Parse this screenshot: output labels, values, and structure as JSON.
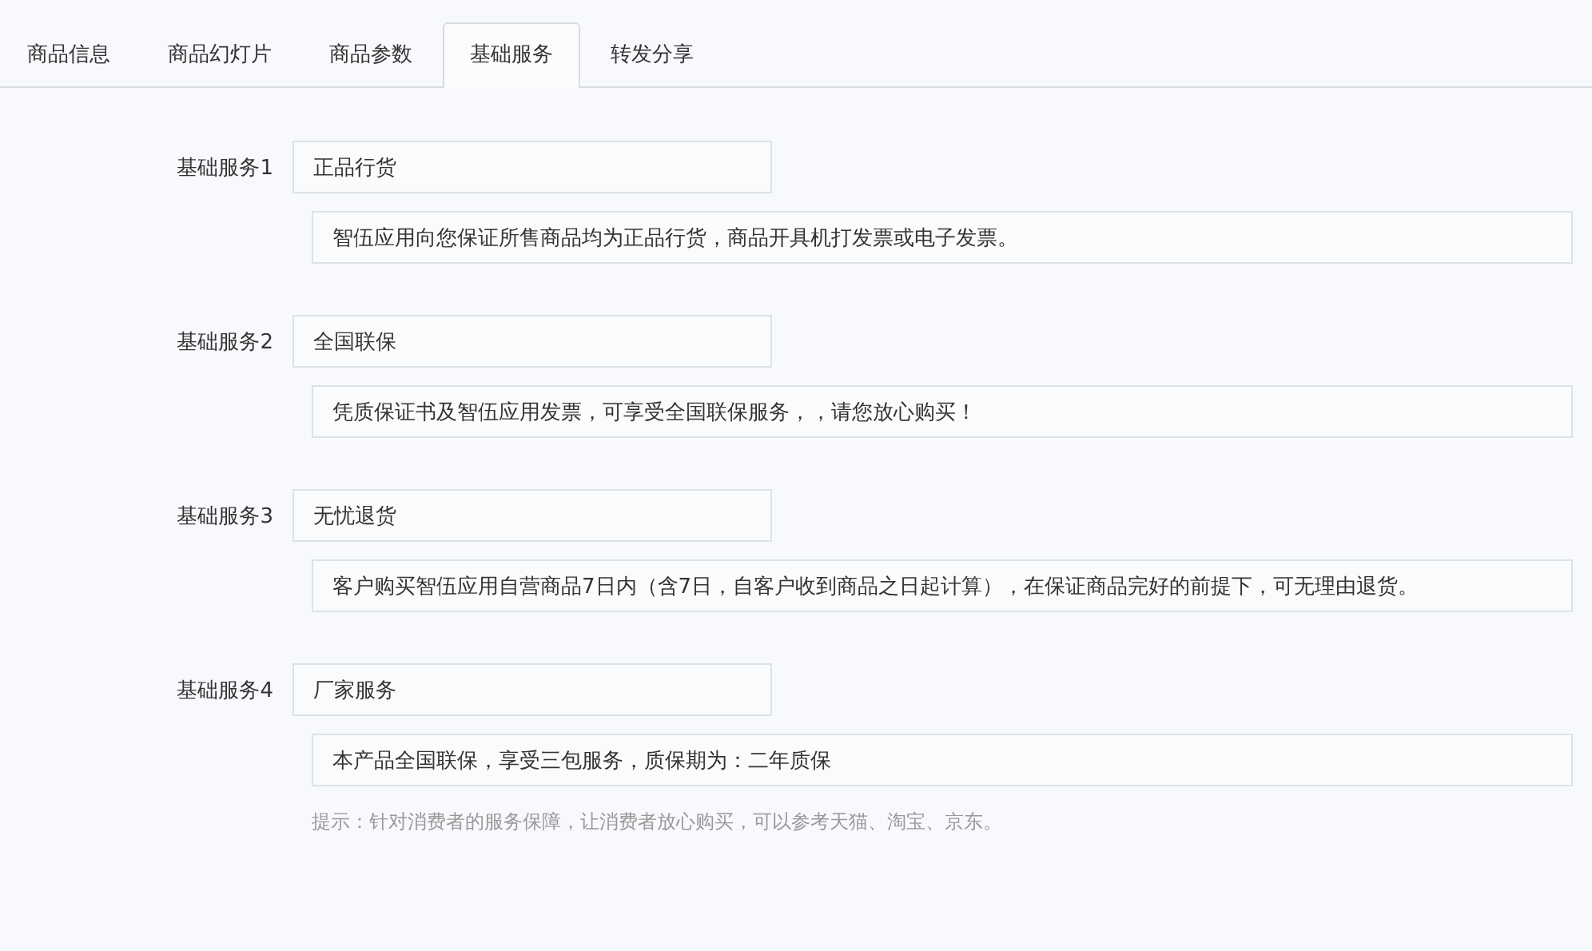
{
  "tabs": [
    {
      "label": "商品信息",
      "selected": false
    },
    {
      "label": "商品幻灯片",
      "selected": false
    },
    {
      "label": "商品参数",
      "selected": false
    },
    {
      "label": "基础服务",
      "selected": true
    },
    {
      "label": "转发分享",
      "selected": false
    }
  ],
  "services": [
    {
      "label": "基础服务1",
      "name": "正品行货",
      "description": "智伍应用向您保证所售商品均为正品行货，商品开具机打发票或电子发票。"
    },
    {
      "label": "基础服务2",
      "name": "全国联保",
      "description": "凭质保证书及智伍应用发票，可享受全国联保服务，，请您放心购买！"
    },
    {
      "label": "基础服务3",
      "name": "无忧退货",
      "description": "客户购买智伍应用自营商品7日内（含7日，自客户收到商品之日起计算），在保证商品完好的前提下，可无理由退货。"
    },
    {
      "label": "基础服务4",
      "name": "厂家服务",
      "description": "本产品全国联保，享受三包服务，质保期为：二年质保"
    }
  ],
  "hint": "提示：针对消费者的服务保障，让消费者放心购买，可以参考天猫、淘宝、京东。"
}
